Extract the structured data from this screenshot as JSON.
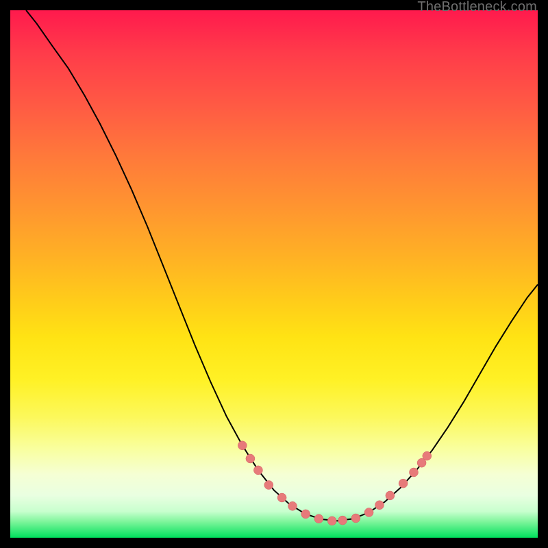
{
  "watermark": "TheBottleneck.com",
  "colors": {
    "curve_stroke": "#000000",
    "marker_fill": "#e77a7a",
    "marker_stroke": "#d46060"
  },
  "chart_data": {
    "type": "line",
    "title": "",
    "xlabel": "",
    "ylabel": "",
    "xlim": [
      0,
      100
    ],
    "ylim": [
      0,
      100
    ],
    "curve": [
      {
        "x": 3.0,
        "y": 100.0
      },
      {
        "x": 5.0,
        "y": 97.5
      },
      {
        "x": 8.0,
        "y": 93.2
      },
      {
        "x": 11.0,
        "y": 89.0
      },
      {
        "x": 14.0,
        "y": 84.0
      },
      {
        "x": 17.0,
        "y": 78.5
      },
      {
        "x": 20.0,
        "y": 72.5
      },
      {
        "x": 23.0,
        "y": 66.0
      },
      {
        "x": 26.0,
        "y": 59.0
      },
      {
        "x": 29.0,
        "y": 51.5
      },
      {
        "x": 32.0,
        "y": 44.0
      },
      {
        "x": 35.0,
        "y": 36.5
      },
      {
        "x": 38.0,
        "y": 29.5
      },
      {
        "x": 41.0,
        "y": 23.0
      },
      {
        "x": 44.0,
        "y": 17.5
      },
      {
        "x": 47.0,
        "y": 12.8
      },
      {
        "x": 50.0,
        "y": 9.0
      },
      {
        "x": 53.0,
        "y": 6.3
      },
      {
        "x": 56.0,
        "y": 4.5
      },
      {
        "x": 59.0,
        "y": 3.5
      },
      {
        "x": 62.0,
        "y": 3.2
      },
      {
        "x": 65.0,
        "y": 3.6
      },
      {
        "x": 68.0,
        "y": 4.8
      },
      {
        "x": 71.0,
        "y": 6.8
      },
      {
        "x": 74.0,
        "y": 9.5
      },
      {
        "x": 77.0,
        "y": 12.8
      },
      {
        "x": 80.0,
        "y": 16.6
      },
      {
        "x": 83.0,
        "y": 21.0
      },
      {
        "x": 86.0,
        "y": 25.8
      },
      {
        "x": 89.0,
        "y": 31.0
      },
      {
        "x": 92.0,
        "y": 36.2
      },
      {
        "x": 95.0,
        "y": 41.0
      },
      {
        "x": 98.0,
        "y": 45.5
      },
      {
        "x": 100.0,
        "y": 48.0
      }
    ],
    "markers": [
      {
        "x": 44.0,
        "y": 17.5
      },
      {
        "x": 45.5,
        "y": 15.0
      },
      {
        "x": 47.0,
        "y": 12.8
      },
      {
        "x": 49.0,
        "y": 10.0
      },
      {
        "x": 51.5,
        "y": 7.6
      },
      {
        "x": 53.5,
        "y": 6.0
      },
      {
        "x": 56.0,
        "y": 4.5
      },
      {
        "x": 58.5,
        "y": 3.6
      },
      {
        "x": 61.0,
        "y": 3.2
      },
      {
        "x": 63.0,
        "y": 3.3
      },
      {
        "x": 65.5,
        "y": 3.7
      },
      {
        "x": 68.0,
        "y": 4.8
      },
      {
        "x": 70.0,
        "y": 6.2
      },
      {
        "x": 72.0,
        "y": 8.0
      },
      {
        "x": 74.5,
        "y": 10.3
      },
      {
        "x": 76.5,
        "y": 12.4
      },
      {
        "x": 78.0,
        "y": 14.2
      },
      {
        "x": 79.0,
        "y": 15.5
      }
    ]
  }
}
